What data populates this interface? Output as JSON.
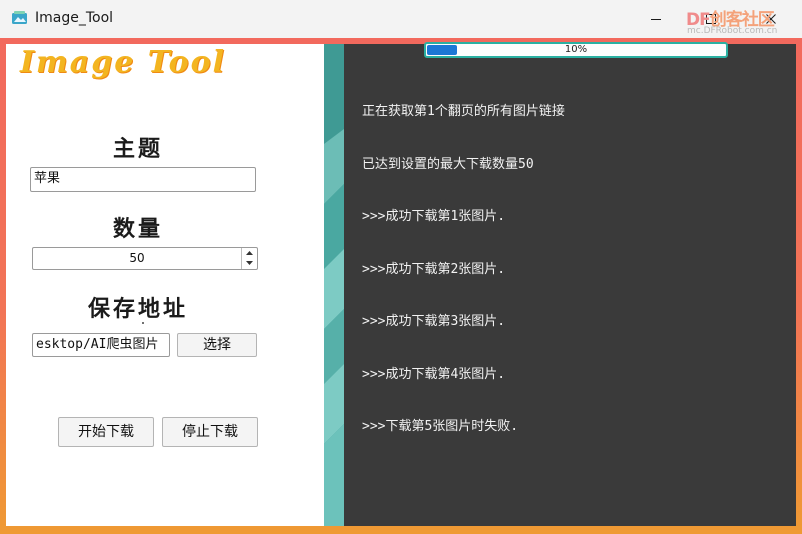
{
  "window": {
    "title": "Image_Tool",
    "minimize_glyph": "—",
    "close_glyph": "✕"
  },
  "watermark": {
    "logo_prefix": "DF",
    "logo_text": "创客社区",
    "url": "mc.DFRobot.com.cn"
  },
  "left": {
    "logo": "Image Tool",
    "topic_label": "主题",
    "topic_value": "苹果",
    "count_label": "数量",
    "count_value": "50",
    "path_label": "保存地址",
    "path_value": "esktop/AI爬虫图片",
    "choose_button": "选择",
    "start_button": "开始下载",
    "stop_button": "停止下载"
  },
  "right": {
    "progress": {
      "value_fraction": 0.1,
      "label": "10%"
    },
    "log": [
      "正在获取第1个翻页的所有图片链接",
      "已达到设置的最大下载数量50",
      ">>>成功下载第1张图片.",
      ">>>成功下载第2张图片.",
      ">>>成功下载第3张图片.",
      ">>>成功下载第4张图片.",
      ">>>下载第5张图片时失败."
    ]
  },
  "colors": {
    "frame_top": "#f2695d",
    "frame_bottom": "#ef9a33",
    "stripe_dark": "#3f9a94",
    "stripe_light": "#7dcbc4",
    "log_background": "#3a3a3a",
    "progress_fill": "#1b77d6",
    "progress_border": "#2bb0a2",
    "logo_color": "#f3b520"
  },
  "icons": {
    "app": "image-app-icon",
    "minimize": "minimize-icon",
    "maximize": "maximize-icon",
    "close": "close-icon",
    "spin_up": "chevron-up-icon",
    "spin_down": "chevron-down-icon"
  }
}
